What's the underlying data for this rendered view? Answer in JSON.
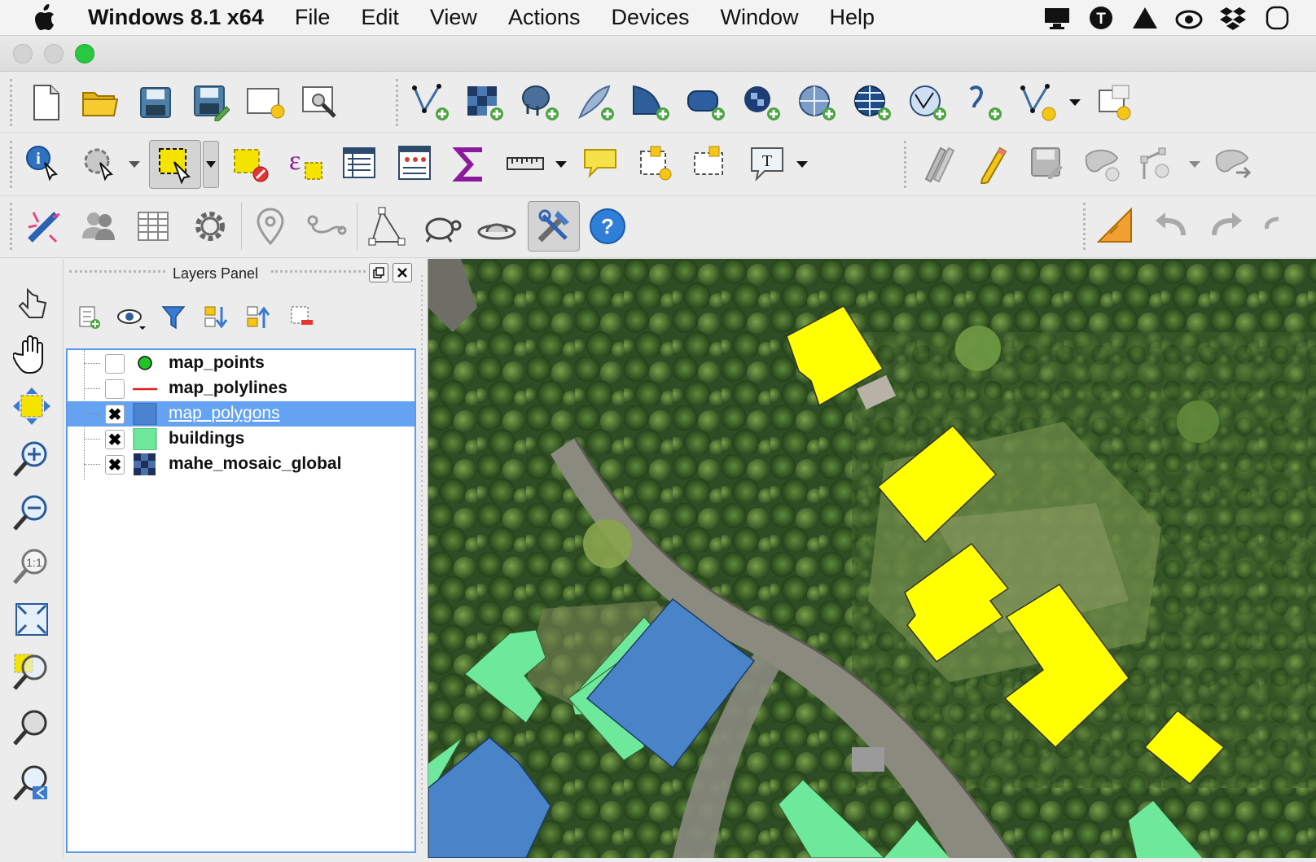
{
  "menubar": {
    "app_name": "Windows 8.1 x64",
    "menus": [
      "File",
      "Edit",
      "View",
      "Actions",
      "Devices",
      "Window",
      "Help"
    ]
  },
  "layers_panel": {
    "title": "Layers Panel",
    "layers": [
      {
        "name": "map_points",
        "checked": false,
        "symbol": "point",
        "color": "#22c422"
      },
      {
        "name": "map_polylines",
        "checked": false,
        "symbol": "line",
        "color": "#e02020"
      },
      {
        "name": "map_polygons",
        "checked": true,
        "symbol": "fill",
        "color": "#4a84d0",
        "selected": true
      },
      {
        "name": "buildings",
        "checked": true,
        "symbol": "fill",
        "color": "#6ee89a"
      },
      {
        "name": "mahe_mosaic_global",
        "checked": true,
        "symbol": "raster",
        "color": "#2b4a8a"
      }
    ]
  },
  "colors": {
    "accent_selection": "#64a3f2",
    "yellow_polygon": "#ffff00",
    "blue_polygon": "#4a84c8",
    "green_polygon": "#6ee89a"
  }
}
